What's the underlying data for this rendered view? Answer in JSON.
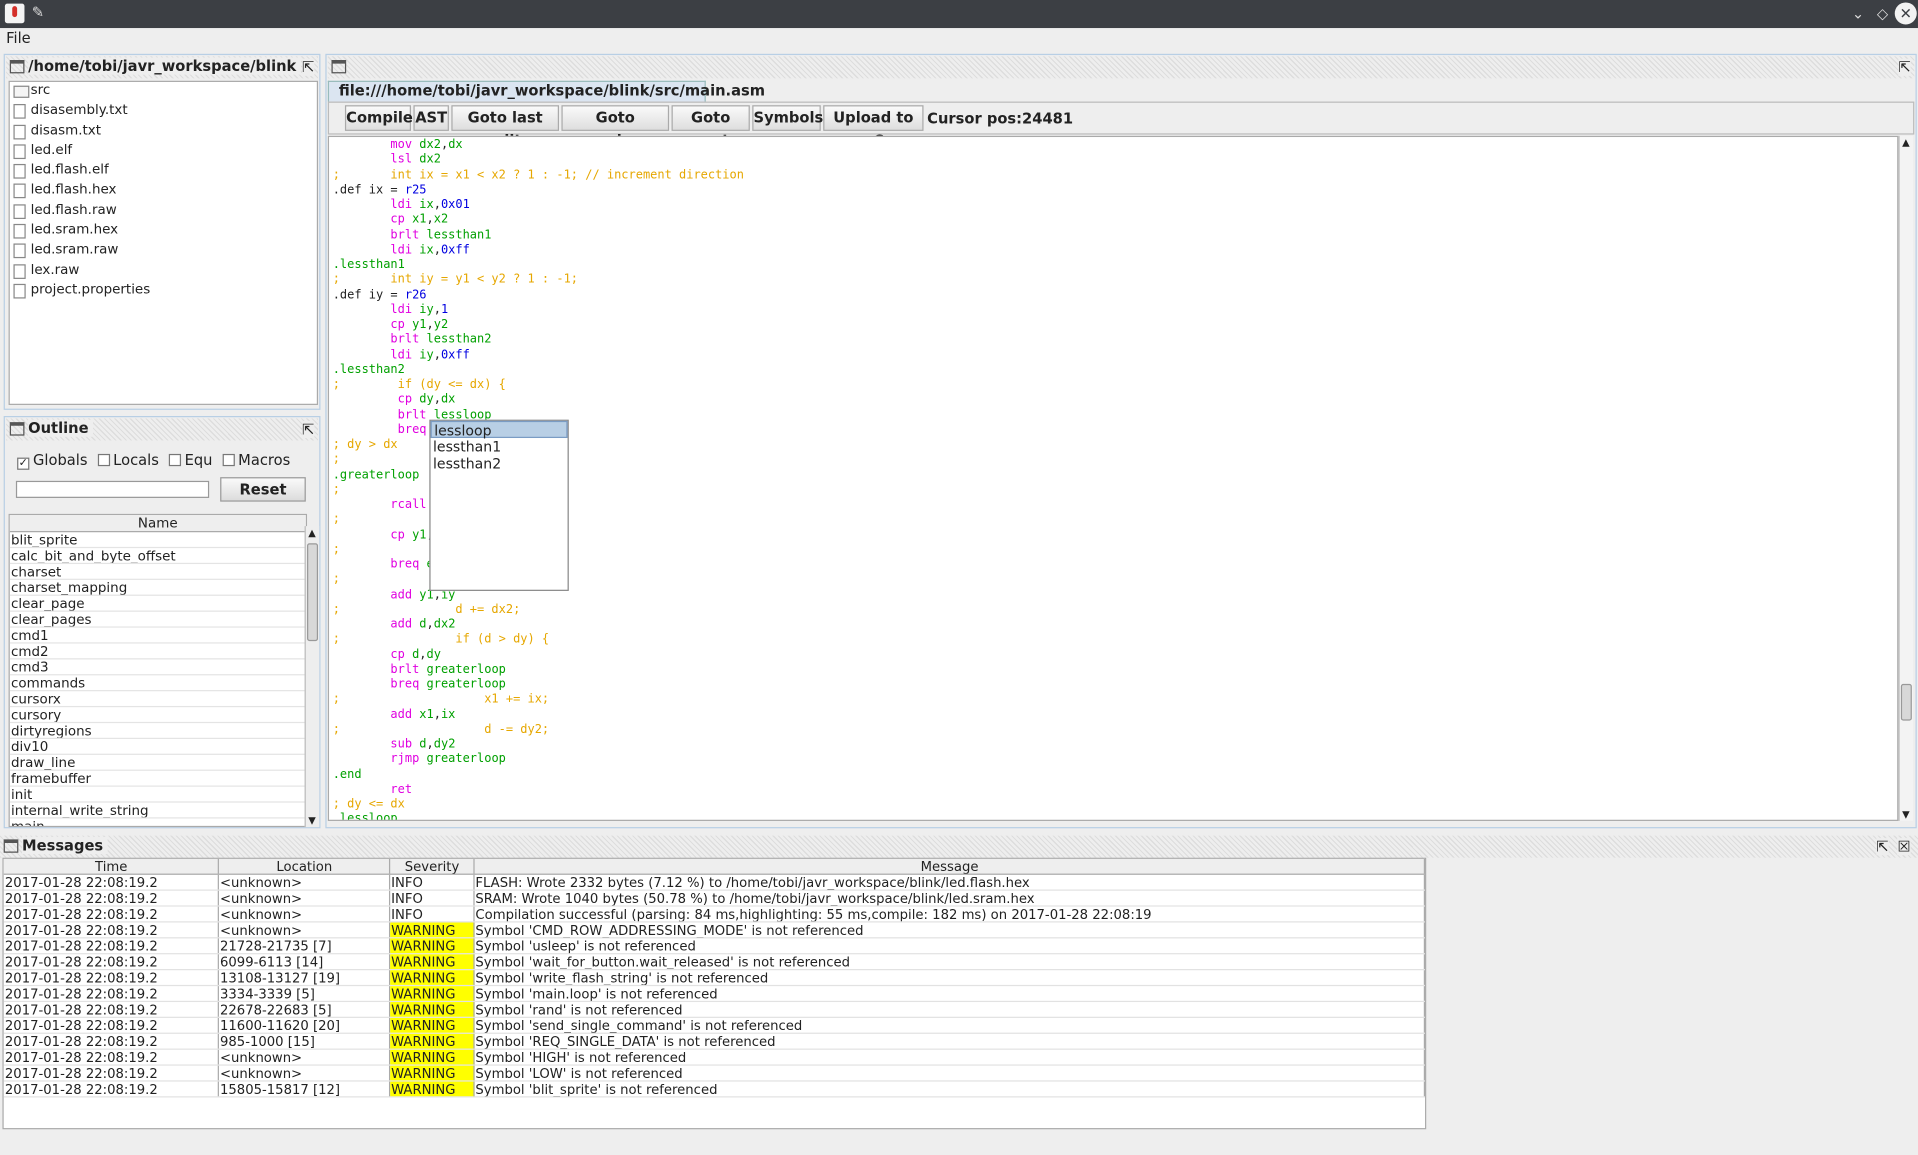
{
  "window": {
    "title": ""
  },
  "menu": {
    "file": "File"
  },
  "project": {
    "title": "/home/tobi/javr_workspace/blink",
    "files": [
      "src",
      "disasembly.txt",
      "disasm.txt",
      "led.elf",
      "led.flash.elf",
      "led.flash.hex",
      "led.flash.raw",
      "led.sram.hex",
      "led.sram.raw",
      "lex.raw",
      "project.properties"
    ]
  },
  "outline": {
    "title": "Outline",
    "filters": [
      {
        "label": "Globals",
        "checked": true
      },
      {
        "label": "Locals",
        "checked": false
      },
      {
        "label": "Equ",
        "checked": false
      },
      {
        "label": "Macros",
        "checked": false
      }
    ],
    "filter_value": "",
    "reset_label": "Reset",
    "column": "Name",
    "symbols": [
      "blit_sprite",
      "calc_bit_and_byte_offset",
      "charset",
      "charset_mapping",
      "clear_page",
      "clear_pages",
      "cmd1",
      "cmd2",
      "cmd3",
      "commands",
      "cursorx",
      "cursory",
      "dirtyregions",
      "div10",
      "draw_line",
      "framebuffer",
      "init",
      "internal_write_string",
      "main"
    ]
  },
  "editor": {
    "tab": "file:///home/tobi/javr_workspace/blink/src/main.asm",
    "toolbar": {
      "compile": "Compile",
      "ast": "AST",
      "goto_last_edit": "Goto last edit",
      "goto_previous": "Goto previous",
      "goto_next": "Goto next",
      "symbols": "Symbols",
      "upload": "Upload to uC",
      "cursor_pos": "Cursor pos:24481"
    },
    "lines": [
      "        mov dx2,dx",
      "        lsl dx2",
      ";       int ix = x1 < x2 ? 1 : -1; // increment direction",
      ".def ix = r25",
      "        ldi ix,0x01",
      "        cp x1,x2",
      "        brlt lessthan1",
      "        ldi ix,0xff",
      ".lessthan1",
      ";       int iy = y1 < y2 ? 1 : -1;",
      ".def iy = r26",
      "        ldi iy,1",
      "        cp y1,y2",
      "        brlt lessthan2",
      "        ldi iy,0xff",
      ".lessthan2",
      ";        if (dy <= dx) {",
      "         cp dy,dx",
      "         brlt lessloop",
      "         breq",
      "; dy > dx",
      ";             f",
      ".greaterloop",
      ";",
      "        rcall",
      ";",
      "        cp y1,",
      ";",
      "        breq e",
      ";",
      "        add y1,iy",
      ";                d += dx2;",
      "        add d,dx2",
      ";                if (d > dy) {",
      "        cp d,dy",
      "        brlt greaterloop",
      "        breq greaterloop",
      ";                    x1 += ix;",
      "        add x1,ix",
      ";                    d -= dy2;",
      "        sub d,dy2",
      "        rjmp greaterloop",
      ".end",
      "        ret",
      "; dy <= dx",
      ".lessloop"
    ],
    "completion": [
      "lessloop",
      "lessthan1",
      "lessthan2"
    ]
  },
  "messages": {
    "title": "Messages",
    "columns": [
      "Time",
      "Location",
      "Severity",
      "Message"
    ],
    "rows": [
      {
        "time": "2017-01-28 22:08:19.2",
        "location": "<unknown>",
        "severity": "INFO",
        "message": "FLASH: Wrote 2332 bytes (7.12 %) to /home/tobi/javr_workspace/blink/led.flash.hex"
      },
      {
        "time": "2017-01-28 22:08:19.2",
        "location": "<unknown>",
        "severity": "INFO",
        "message": "SRAM: Wrote 1040 bytes (50.78 %) to /home/tobi/javr_workspace/blink/led.sram.hex"
      },
      {
        "time": "2017-01-28 22:08:19.2",
        "location": "<unknown>",
        "severity": "INFO",
        "message": "Compilation successful (parsing: 84 ms,highlighting: 55 ms,compile: 182 ms) on 2017-01-28 22:08:19"
      },
      {
        "time": "2017-01-28 22:08:19.2",
        "location": "<unknown>",
        "severity": "WARNING",
        "message": "Symbol 'CMD_ROW_ADDRESSING_MODE' is not referenced"
      },
      {
        "time": "2017-01-28 22:08:19.2",
        "location": "21728-21735 [7]",
        "severity": "WARNING",
        "message": "Symbol 'usleep' is not referenced"
      },
      {
        "time": "2017-01-28 22:08:19.2",
        "location": "6099-6113 [14]",
        "severity": "WARNING",
        "message": "Symbol 'wait_for_button.wait_released' is not referenced"
      },
      {
        "time": "2017-01-28 22:08:19.2",
        "location": "13108-13127 [19]",
        "severity": "WARNING",
        "message": "Symbol 'write_flash_string' is not referenced"
      },
      {
        "time": "2017-01-28 22:08:19.2",
        "location": "3334-3339 [5]",
        "severity": "WARNING",
        "message": "Symbol 'main.loop' is not referenced"
      },
      {
        "time": "2017-01-28 22:08:19.2",
        "location": "22678-22683 [5]",
        "severity": "WARNING",
        "message": "Symbol 'rand' is not referenced"
      },
      {
        "time": "2017-01-28 22:08:19.2",
        "location": "11600-11620 [20]",
        "severity": "WARNING",
        "message": "Symbol 'send_single_command' is not referenced"
      },
      {
        "time": "2017-01-28 22:08:19.2",
        "location": "985-1000 [15]",
        "severity": "WARNING",
        "message": "Symbol 'REQ_SINGLE_DATA' is not referenced"
      },
      {
        "time": "2017-01-28 22:08:19.2",
        "location": "<unknown>",
        "severity": "WARNING",
        "message": "Symbol 'HIGH' is not referenced"
      },
      {
        "time": "2017-01-28 22:08:19.2",
        "location": "<unknown>",
        "severity": "WARNING",
        "message": "Symbol 'LOW' is not referenced"
      },
      {
        "time": "2017-01-28 22:08:19.2",
        "location": "15805-15817 [12]",
        "severity": "WARNING",
        "message": "Symbol 'blit_sprite' is not referenced"
      }
    ]
  },
  "colors": {
    "warning_bg": "#ffff00",
    "titlebar": "#3c3f44",
    "selection": "#b8cfe5"
  }
}
